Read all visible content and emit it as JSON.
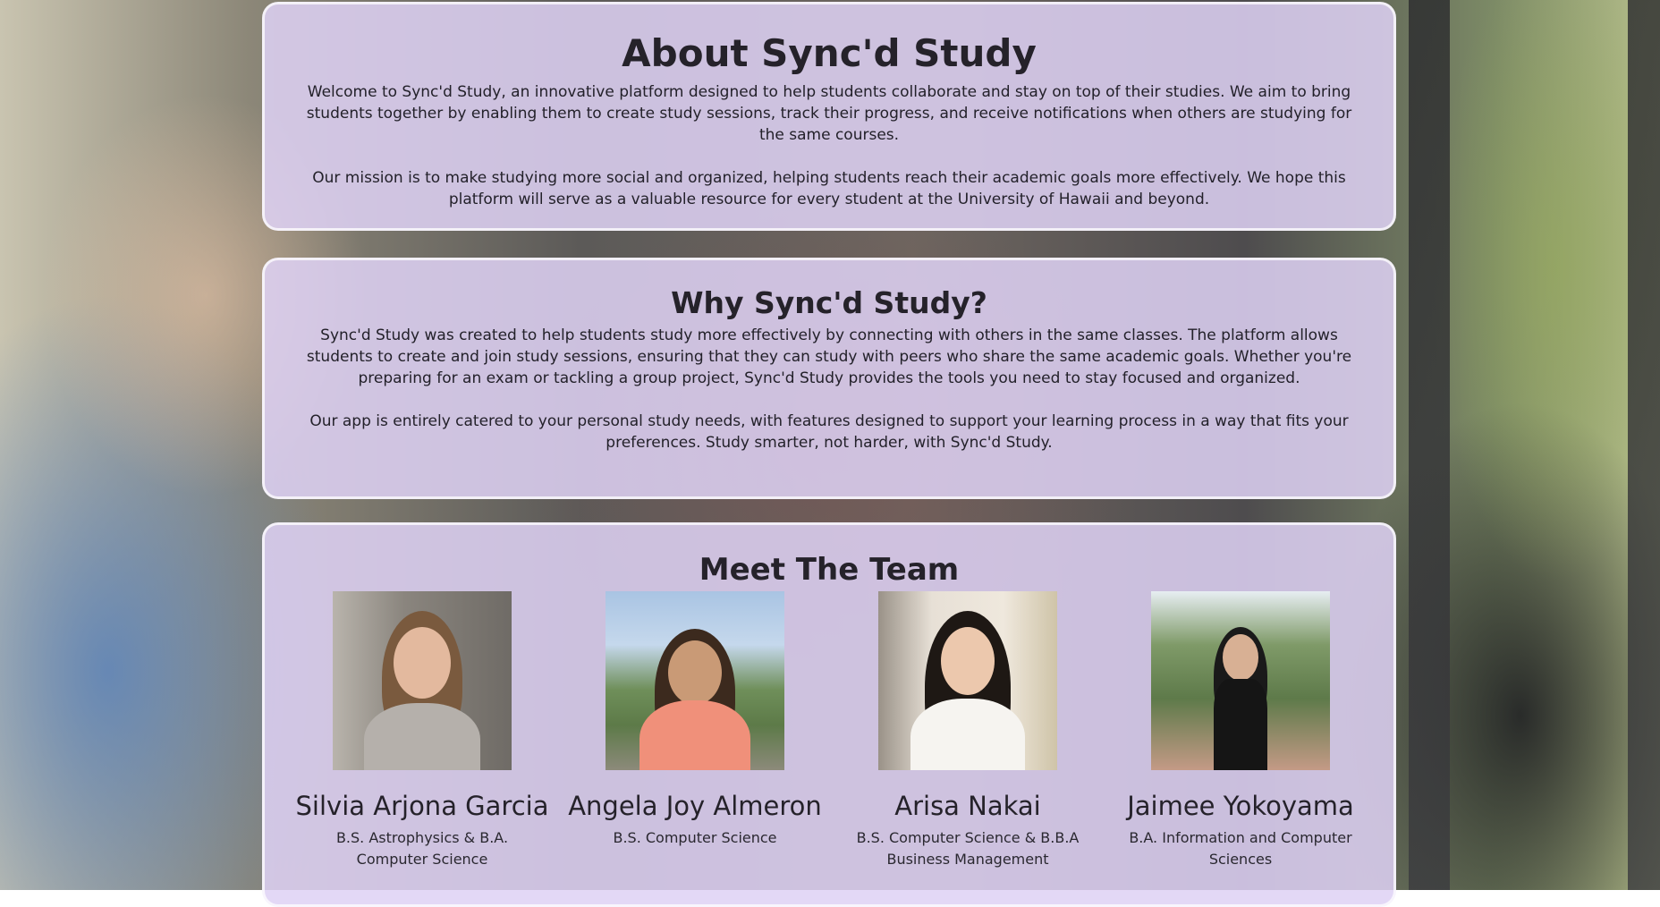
{
  "about": {
    "title": "About Sync'd Study",
    "paragraph1": "Welcome to Sync'd Study, an innovative platform designed to help students collaborate and stay on top of their studies. We aim to bring students together by enabling them to create study sessions, track their progress, and receive notifications when others are studying for the same courses.",
    "paragraph2": "Our mission is to make studying more social and organized, helping students reach their academic goals more effectively. We hope this platform will serve as a valuable resource for every student at the University of Hawaii and beyond."
  },
  "why": {
    "title": "Why Sync'd Study?",
    "paragraph1": "Sync'd Study was created to help students study more effectively by connecting with others in the same classes. The platform allows students to create and join study sessions, ensuring that they can study with peers who share the same academic goals. Whether you're preparing for an exam or tackling a group project, Sync'd Study provides the tools you need to stay focused and organized.",
    "paragraph2": "Our app is entirely catered to your personal study needs, with features designed to support your learning process in a way that fits your preferences. Study smarter, not harder, with Sync'd Study."
  },
  "team": {
    "title": "Meet The Team",
    "members": [
      {
        "name": "Silvia Arjona Garcia",
        "degree": "B.S. Astrophysics & B.A. Computer Science"
      },
      {
        "name": "Angela Joy Almeron",
        "degree": "B.S. Computer Science"
      },
      {
        "name": "Arisa Nakai",
        "degree": "B.S. Computer Science & B.B.A Business Management"
      },
      {
        "name": "Jaimee Yokoyama",
        "degree": "B.A. Information and Computer Sciences"
      }
    ]
  },
  "colors": {
    "card_background": "#ded2f5",
    "text": "#23212a"
  }
}
